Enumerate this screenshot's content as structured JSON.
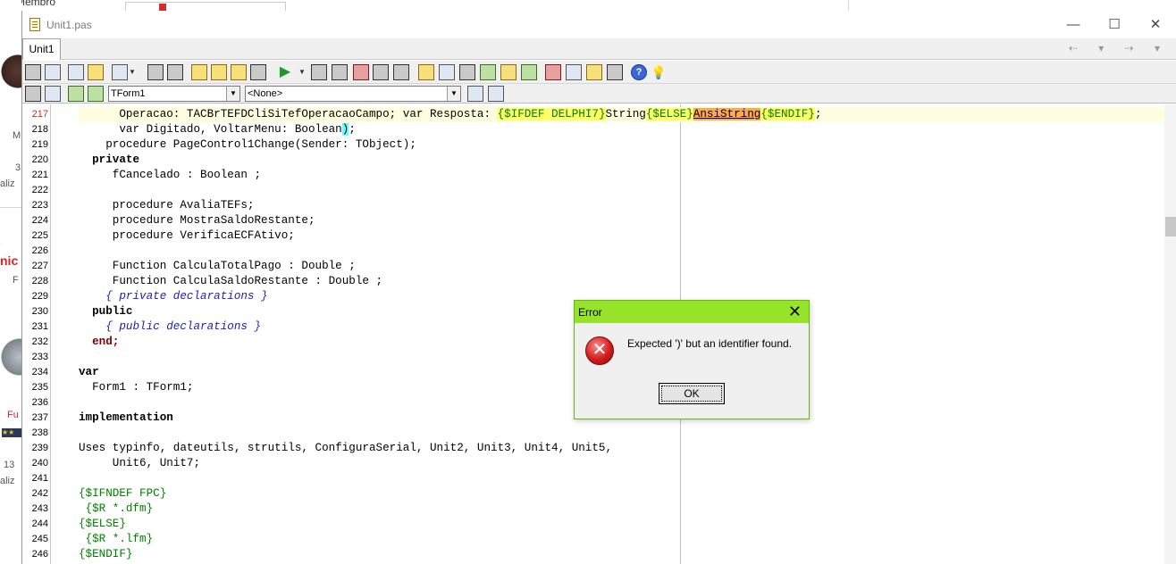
{
  "background": {
    "membro_text": "Membro",
    "side_texts": [
      "M",
      "3",
      "aliz",
      "nic",
      "F",
      "Fu",
      "13",
      "aliz"
    ]
  },
  "window": {
    "title": "Unit1.pas",
    "controls": [
      "—",
      "☐",
      "✕"
    ],
    "tab_label": "Unit1",
    "tab_arrows": "⇠ ▾ ⇢ ▾"
  },
  "toolbar2": {
    "class_combo_value": "TForm1",
    "method_combo_value": "<None>"
  },
  "editor": {
    "current_line": 217,
    "lines": [
      {
        "num": "217"
      },
      {
        "num": "218"
      },
      {
        "num": "219"
      },
      {
        "num": "220"
      },
      {
        "num": "221"
      },
      {
        "num": "222"
      },
      {
        "num": "223"
      },
      {
        "num": "224"
      },
      {
        "num": "225"
      },
      {
        "num": "226"
      },
      {
        "num": "227"
      },
      {
        "num": "228"
      },
      {
        "num": "229"
      },
      {
        "num": "230"
      },
      {
        "num": "231"
      },
      {
        "num": "232"
      },
      {
        "num": "233"
      },
      {
        "num": "234"
      },
      {
        "num": "235"
      },
      {
        "num": "236"
      },
      {
        "num": "237"
      },
      {
        "num": "238"
      },
      {
        "num": "239"
      },
      {
        "num": "240"
      },
      {
        "num": "241"
      },
      {
        "num": "242"
      },
      {
        "num": "243"
      },
      {
        "num": "244"
      },
      {
        "num": "245"
      },
      {
        "num": "246"
      }
    ],
    "code": {
      "l217_a": "      Operacao: TACBrTEFDCliSiTefOperacaoCampo; var Resposta: ",
      "l217_b": "{$IFDEF DELPHI7}",
      "l217_c": "String",
      "l217_d": "{$ELSE}",
      "l217_e": "AnsiString",
      "l217_f": "{$ENDIF}",
      "l217_g": ";",
      "l218_a": "      var Digitado, VoltarMenu: Boolean",
      "l218_b": ")",
      "l218_c": ";",
      "l219": "    procedure PageControl1Change(Sender: TObject);",
      "l220": "  private",
      "l221": "     fCancelado : Boolean ;",
      "l223": "     procedure AvaliaTEFs;",
      "l224": "     procedure MostraSaldoRestante;",
      "l225": "     procedure VerificaECFAtivo;",
      "l227": "     Function CalculaTotalPago : Double ;",
      "l228": "     Function CalculaSaldoRestante : Double ;",
      "l229": "    { private declarations }",
      "l230": "  public",
      "l231": "    { public declarations }",
      "l232": "  end;",
      "l234": "var",
      "l235": "  Form1 : TForm1;",
      "l237": "implementation",
      "l239": "Uses typinfo, dateutils, strutils, ConfiguraSerial, Unit2, Unit3, Unit4, Unit5,",
      "l240": "     Unit6, Unit7;",
      "l242": "{$IFNDEF FPC}",
      "l243": " {$R *.dfm}",
      "l244": "{$ELSE}",
      "l245": " {$R *.lfm}",
      "l246": "{$ENDIF}"
    }
  },
  "dialog": {
    "title": "Error",
    "close": "✕",
    "icon": "error-icon",
    "icon_glyph": "✕",
    "message": "Expected ')' but an identifier found.",
    "ok_label": "OK"
  },
  "colors": {
    "dialog_titlebar": "#96e32a",
    "current_line_number": "#d4291d",
    "directive": "#008000",
    "comment": "#1f1fb0",
    "highlight": "#ffff66"
  }
}
